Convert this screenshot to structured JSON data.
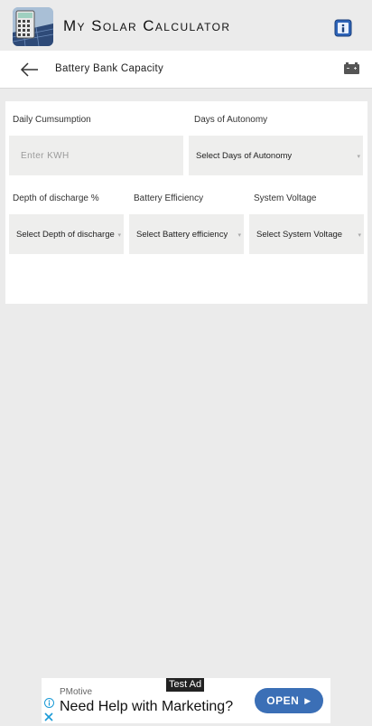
{
  "app": {
    "title": "My Solar Calculator",
    "logo_icon": "solar-calculator-logo",
    "info_icon": "info-icon"
  },
  "subbar": {
    "back_icon": "arrow-left-icon",
    "title": "Battery Bank Capacity",
    "battery_icon": "battery-icon"
  },
  "form": {
    "daily_consumption": {
      "label": "Daily Cumsumption",
      "placeholder": "Enter KWH",
      "value": ""
    },
    "days_autonomy": {
      "label": "Days of Autonomy",
      "value": "Select Days of Autonomy"
    },
    "depth_discharge": {
      "label": "Depth of discharge %",
      "value": "Select Depth of discharge"
    },
    "battery_efficiency": {
      "label": "Battery Efficiency",
      "value": "Select Battery efficiency"
    },
    "system_voltage": {
      "label": "System Voltage",
      "value": "Select System Voltage"
    }
  },
  "ad": {
    "tag": "Test Ad",
    "sponsor": "PMotive",
    "headline": "Need Help with Marketing?",
    "cta": "OPEN",
    "accent": "#3b6fb6"
  }
}
